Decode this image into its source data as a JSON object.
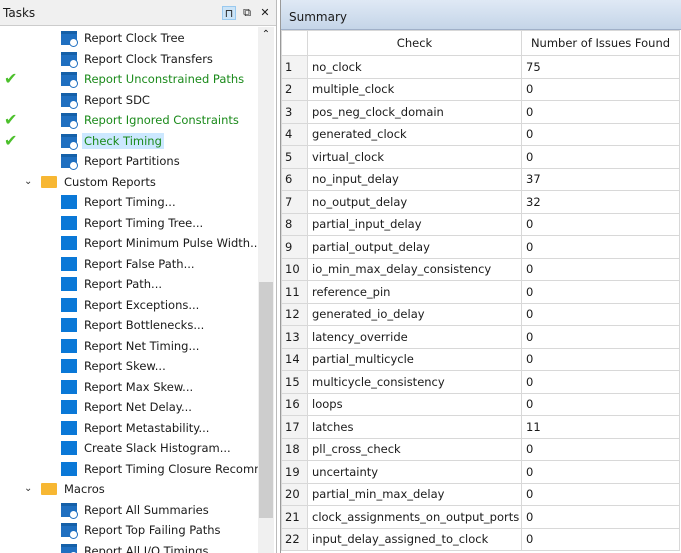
{
  "tasks_panel": {
    "title": "Tasks",
    "pin_icon": "pin-icon",
    "float_icon": "float-icon",
    "close_icon": "close-icon",
    "items": [
      {
        "label": "Report Clock Tree",
        "icon": "report-icon",
        "level": 2,
        "done": false
      },
      {
        "label": "Report Clock Transfers",
        "icon": "report-icon",
        "level": 2,
        "done": false
      },
      {
        "label": "Report Unconstrained Paths",
        "icon": "report-icon",
        "level": 2,
        "done": true
      },
      {
        "label": "Report SDC",
        "icon": "report-icon",
        "level": 2,
        "done": false
      },
      {
        "label": "Report Ignored Constraints",
        "icon": "report-icon",
        "level": 2,
        "done": true
      },
      {
        "label": "Check Timing",
        "icon": "report-icon",
        "level": 2,
        "done": true,
        "selected": true
      },
      {
        "label": "Report Partitions",
        "icon": "report-icon",
        "level": 2,
        "done": false
      },
      {
        "label": "Custom Reports",
        "icon": "folder-icon",
        "level": 1,
        "expanded": true
      },
      {
        "label": "Report Timing...",
        "icon": "custom-report-icon",
        "level": 2
      },
      {
        "label": "Report Timing Tree...",
        "icon": "custom-report-icon",
        "level": 2
      },
      {
        "label": "Report Minimum Pulse Width...",
        "icon": "custom-report-icon",
        "level": 2
      },
      {
        "label": "Report False Path...",
        "icon": "custom-report-icon",
        "level": 2
      },
      {
        "label": "Report Path...",
        "icon": "custom-report-icon",
        "level": 2
      },
      {
        "label": "Report Exceptions...",
        "icon": "custom-report-icon",
        "level": 2
      },
      {
        "label": "Report Bottlenecks...",
        "icon": "custom-report-icon",
        "level": 2
      },
      {
        "label": "Report Net Timing...",
        "icon": "custom-report-icon",
        "level": 2
      },
      {
        "label": "Report Skew...",
        "icon": "custom-report-icon",
        "level": 2
      },
      {
        "label": "Report Max Skew...",
        "icon": "custom-report-icon",
        "level": 2
      },
      {
        "label": "Report Net Delay...",
        "icon": "custom-report-icon",
        "level": 2
      },
      {
        "label": "Report Metastability...",
        "icon": "custom-report-icon",
        "level": 2
      },
      {
        "label": "Create Slack Histogram...",
        "icon": "custom-report-icon",
        "level": 2
      },
      {
        "label": "Report Timing Closure Recommendations...",
        "icon": "custom-report-icon",
        "level": 2
      },
      {
        "label": "Macros",
        "icon": "folder-icon",
        "level": 1,
        "expanded": true
      },
      {
        "label": "Report All Summaries",
        "icon": "report-icon",
        "level": 2
      },
      {
        "label": "Report Top Failing Paths",
        "icon": "report-icon",
        "level": 2
      },
      {
        "label": "Report All I/O Timings",
        "icon": "report-icon",
        "level": 2
      }
    ]
  },
  "summary": {
    "title": "Summary",
    "columns": [
      "",
      "Check",
      "Number of Issues Found"
    ],
    "rows": [
      [
        "1",
        "no_clock",
        "75"
      ],
      [
        "2",
        "multiple_clock",
        "0"
      ],
      [
        "3",
        "pos_neg_clock_domain",
        "0"
      ],
      [
        "4",
        "generated_clock",
        "0"
      ],
      [
        "5",
        "virtual_clock",
        "0"
      ],
      [
        "6",
        "no_input_delay",
        "37"
      ],
      [
        "7",
        "no_output_delay",
        "32"
      ],
      [
        "8",
        "partial_input_delay",
        "0"
      ],
      [
        "9",
        "partial_output_delay",
        "0"
      ],
      [
        "10",
        "io_min_max_delay_consistency",
        "0"
      ],
      [
        "11",
        "reference_pin",
        "0"
      ],
      [
        "12",
        "generated_io_delay",
        "0"
      ],
      [
        "13",
        "latency_override",
        "0"
      ],
      [
        "14",
        "partial_multicycle",
        "0"
      ],
      [
        "15",
        "multicycle_consistency",
        "0"
      ],
      [
        "16",
        "loops",
        "0"
      ],
      [
        "17",
        "latches",
        "11"
      ],
      [
        "18",
        "pll_cross_check",
        "0"
      ],
      [
        "19",
        "uncertainty",
        "0"
      ],
      [
        "20",
        "partial_min_max_delay",
        "0"
      ],
      [
        "21",
        "clock_assignments_on_output_ports",
        "0"
      ],
      [
        "22",
        "input_delay_assigned_to_clock",
        "0"
      ]
    ]
  }
}
